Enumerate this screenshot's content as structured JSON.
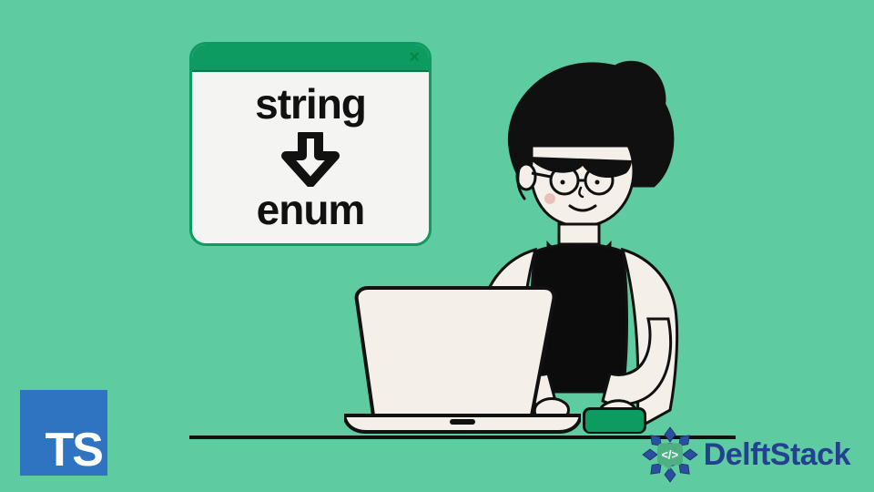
{
  "dialog": {
    "top_word": "string",
    "bottom_word": "enum",
    "close_glyph": "×"
  },
  "ts_badge": {
    "label": "TS"
  },
  "delft": {
    "text": "DelftStack",
    "code_symbol": "</>"
  },
  "colors": {
    "bg": "#5ecba1",
    "accent_green": "#0e9b62",
    "ts_blue": "#2f74c0",
    "delft_blue": "#23418e"
  }
}
